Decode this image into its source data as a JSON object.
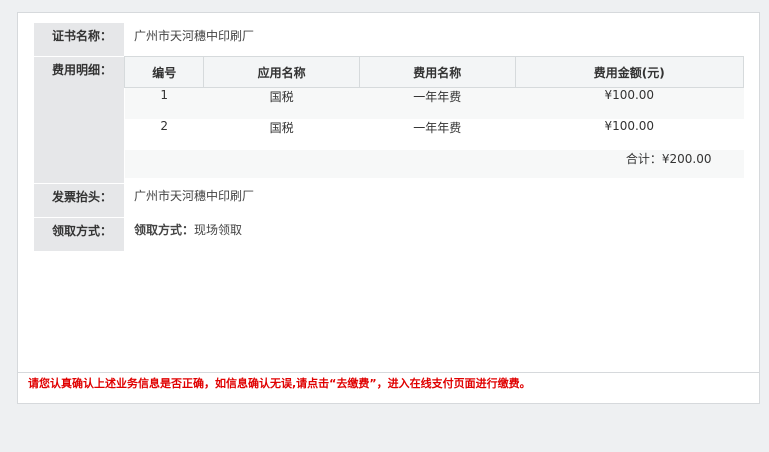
{
  "cert": {
    "label": "证书名称：",
    "value": "广州市天河穗中印刷厂"
  },
  "fee": {
    "label": "费用明细：",
    "headers": [
      "编号",
      "应用名称",
      "费用名称",
      "费用金额(元)"
    ],
    "rows": [
      {
        "no": "1",
        "app": "国税",
        "name": "一年年费",
        "amount": "¥100.00"
      },
      {
        "no": "2",
        "app": "国税",
        "name": "一年年费",
        "amount": "¥100.00"
      }
    ],
    "total": "合计：¥200.00"
  },
  "invoice": {
    "label": "发票抬头：",
    "value": "广州市天河穗中印刷厂"
  },
  "pickup": {
    "label": "领取方式：",
    "value_label": "领取方式：",
    "value": "现场领取"
  },
  "notice": "请您认真确认上述业务信息是否正确，如信息确认无误,请点击“去缴费”，进入在线支付页面进行缴费。"
}
